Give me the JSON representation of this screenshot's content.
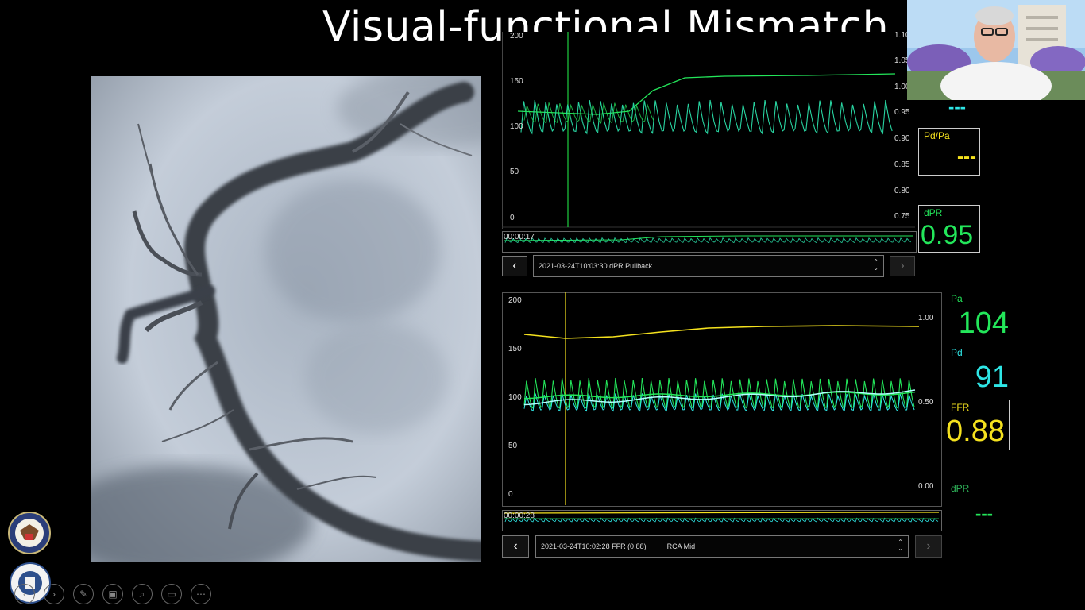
{
  "slide": {
    "title": "Visual-functional Mismatch"
  },
  "top_chart": {
    "left_axis": [
      "200",
      "150",
      "100",
      "50",
      "0"
    ],
    "right_axis": [
      "1.10",
      "1.05",
      "1.00",
      "0.95",
      "0.90",
      "0.85",
      "0.80",
      "0.75"
    ],
    "timer": "00:00:17",
    "recording_label": "2021-03-24T10:03:30  dPR Pullback"
  },
  "top_values": {
    "dashes_cyan": "---",
    "pdpa_label": "Pd/Pa",
    "pdpa_value": "---",
    "dpr_label": "dPR",
    "dpr_value": "0.95"
  },
  "bottom_chart": {
    "left_axis": [
      "200",
      "150",
      "100",
      "50",
      "0"
    ],
    "right_axis": [
      "1.00",
      "0.50",
      "0.00"
    ],
    "timer": "00:00:28",
    "recording_label": "2021-03-24T10:02:28   FFR (0.88)",
    "vessel": "RCA Mid"
  },
  "bottom_values": {
    "pa_label": "Pa",
    "pa_value": "104",
    "pd_label": "Pd",
    "pd_value": "91",
    "ffr_label": "FFR",
    "ffr_value": "0.88",
    "dpr_label": "dPR",
    "dpr_value": "---"
  },
  "nav": {
    "prev": "‹",
    "next": "›",
    "dropdown_up": "⌃",
    "dropdown_down": "⌄"
  },
  "colors": {
    "green": "#23e65a",
    "cyan": "#2ee6e6",
    "yellow": "#f5e21e",
    "darkgreen": "#2fb55a"
  }
}
